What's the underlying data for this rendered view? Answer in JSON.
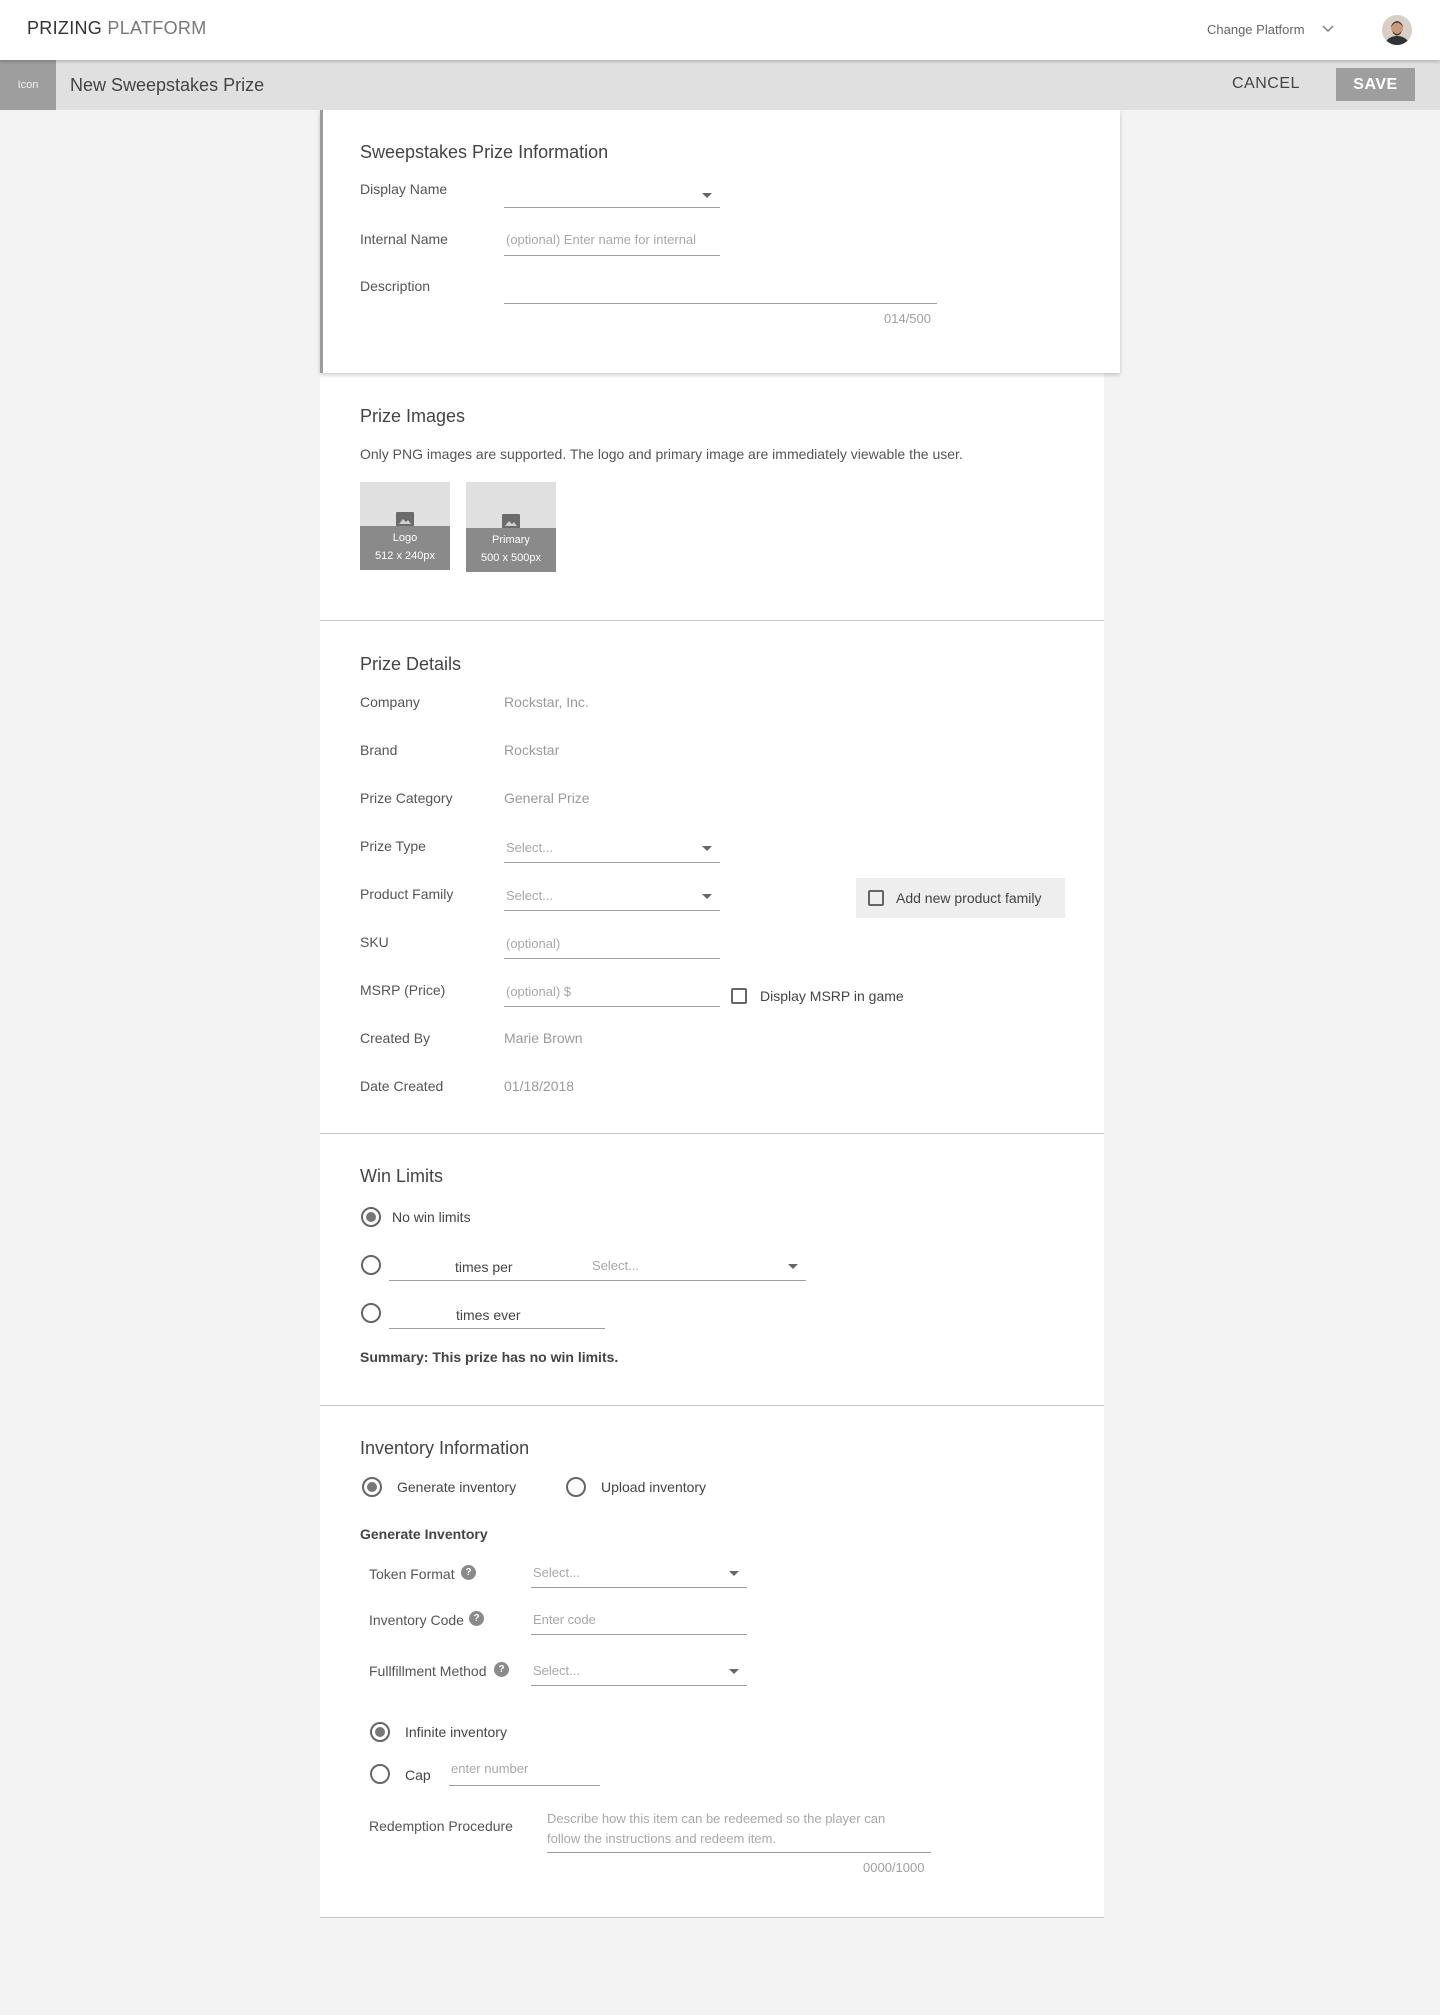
{
  "topbar": {
    "brand_primary": "PRIZING",
    "brand_secondary": "PLATFORM",
    "platform_label": "Change Platform",
    "chevron_icon": "chevron-down-icon",
    "avatar_icon": "user-avatar"
  },
  "subbar": {
    "icon_label": "Icon",
    "title": "New Sweepstakes Prize",
    "cancel_label": "CANCEL",
    "save_label": "SAVE"
  },
  "info": {
    "heading": "Sweepstakes Prize Information",
    "display_name_label": "Display Name",
    "internal_name_label": "Internal Name",
    "internal_name_placeholder": "(optional) Enter name for internal",
    "description_label": "Description",
    "description_counter": "014/500"
  },
  "images": {
    "heading": "Prize Images",
    "note": "Only PNG images are supported. The logo and primary image are immediately viewable the user.",
    "items": [
      {
        "name": "Logo",
        "size": "512 x 240px"
      },
      {
        "name": "Primary",
        "size": "500 x 500px"
      }
    ]
  },
  "details": {
    "heading": "Prize Details",
    "company_label": "Company",
    "company_value": "Rockstar, Inc.",
    "brand_label": "Brand",
    "brand_value": "Rockstar",
    "category_label": "Prize Category",
    "category_value": "General Prize",
    "type_label": "Prize Type",
    "type_placeholder": "Select...",
    "family_label": "Product Family",
    "family_placeholder": "Select...",
    "add_family_label": "Add new product family",
    "sku_label": "SKU",
    "sku_placeholder": "(optional)",
    "msrp_label": "MSRP (Price)",
    "msrp_placeholder": "(optional) $",
    "display_msrp_label": "Display MSRP in game",
    "created_by_label": "Created By",
    "created_by_value": "Marie Brown",
    "date_label": "Date Created",
    "date_value": "01/18/2018"
  },
  "win": {
    "heading": "Win Limits",
    "no_limits_label": "No win limits",
    "times_per_label": "times per",
    "period_placeholder": "Select...",
    "times_ever_label": "times ever",
    "summary": "Summary: This prize has no win limits.",
    "selected": "none"
  },
  "inventory": {
    "heading": "Inventory Information",
    "generate_label": "Generate inventory",
    "upload_label": "Upload inventory",
    "sub_heading": "Generate Inventory",
    "token_label": "Token Format",
    "token_placeholder": "Select...",
    "code_label": "Inventory Code",
    "code_placeholder": "Enter code",
    "fulfill_label": "Fullfillment Method",
    "fulfill_placeholder": "Select...",
    "help_glyph": "?",
    "infinite_label": "Infinite inventory",
    "cap_label": "Cap",
    "cap_placeholder": "enter number",
    "redeem_label": "Redemption Procedure",
    "redeem_placeholder_1": "Describe how this item can be redeemed so the player can",
    "redeem_placeholder_2": "follow the instructions and redeem item.",
    "redeem_counter": "0000/1000"
  }
}
